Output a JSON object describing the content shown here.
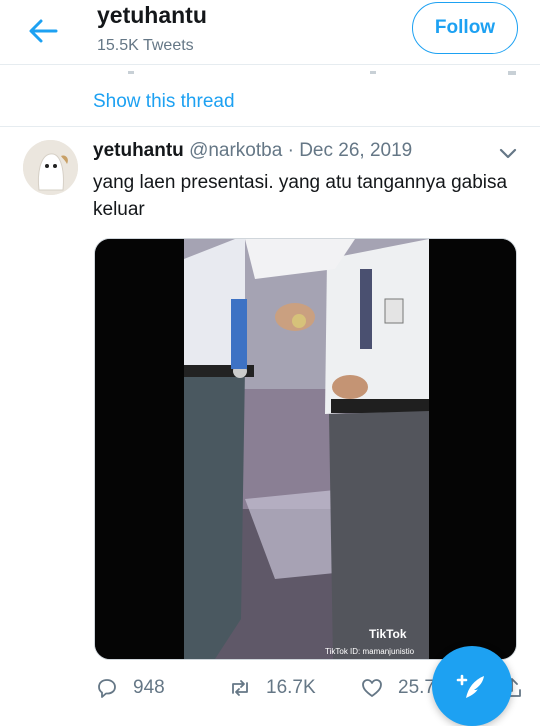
{
  "header": {
    "title": "yetuhantu",
    "tweet_count": "15.5K Tweets",
    "follow_label": "Follow"
  },
  "thread": {
    "show_thread_label": "Show this thread"
  },
  "tweet": {
    "display_name": "yetuhantu",
    "handle": "@narkotba",
    "separator": "·",
    "date": "Dec 26, 2019",
    "text": "yang laen presentasi. yang atu tangannya gabisa keluar",
    "media": {
      "watermark_logo": "TikTok",
      "watermark_id": "TikTok ID: mamanjunistio"
    },
    "actions": {
      "replies": "948",
      "retweets": "16.7K",
      "likes": "25.7K"
    }
  },
  "colors": {
    "accent": "#1da1f2",
    "muted": "#657786",
    "text": "#14171a"
  },
  "icons": [
    "back-arrow-icon",
    "chevron-down-icon",
    "reply-icon",
    "retweet-icon",
    "like-icon",
    "share-icon",
    "compose-tweet-icon"
  ]
}
